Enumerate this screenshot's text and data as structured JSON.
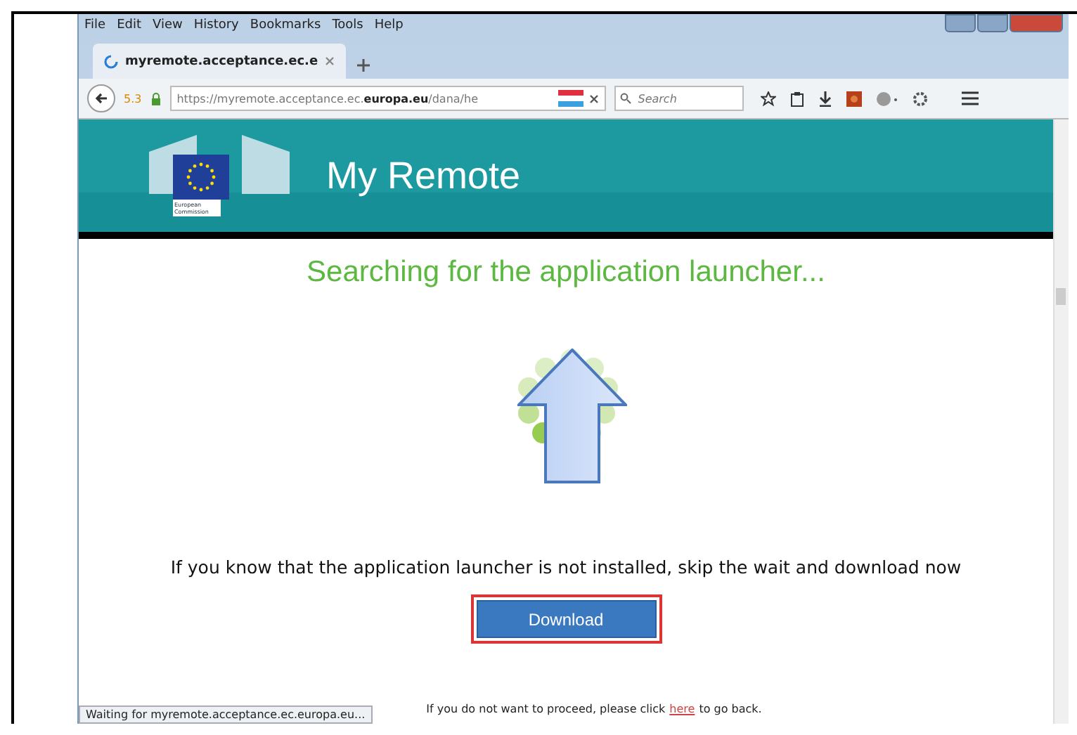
{
  "menu": [
    "File",
    "Edit",
    "View",
    "History",
    "Bookmarks",
    "Tools",
    "Help"
  ],
  "tab": {
    "title": "myremote.acceptance.ec.e",
    "selected": true
  },
  "address": {
    "badge": "5.3",
    "url": "https://myremote.acceptance.ec.**europa.eu**/dana/he"
  },
  "search": {
    "placeholder": "Search"
  },
  "header": {
    "logo_caption": "European Commission",
    "title": "My Remote"
  },
  "heading": "Searching for the application launcher...",
  "message": "If you know that the application launcher is not installed, skip the wait and download now",
  "download_button": "Download",
  "footer": {
    "before": "If you do not want to proceed, please click",
    "link": "here",
    "after": "to go back."
  },
  "status_bar": "Waiting for myremote.acceptance.ec.europa.eu..."
}
